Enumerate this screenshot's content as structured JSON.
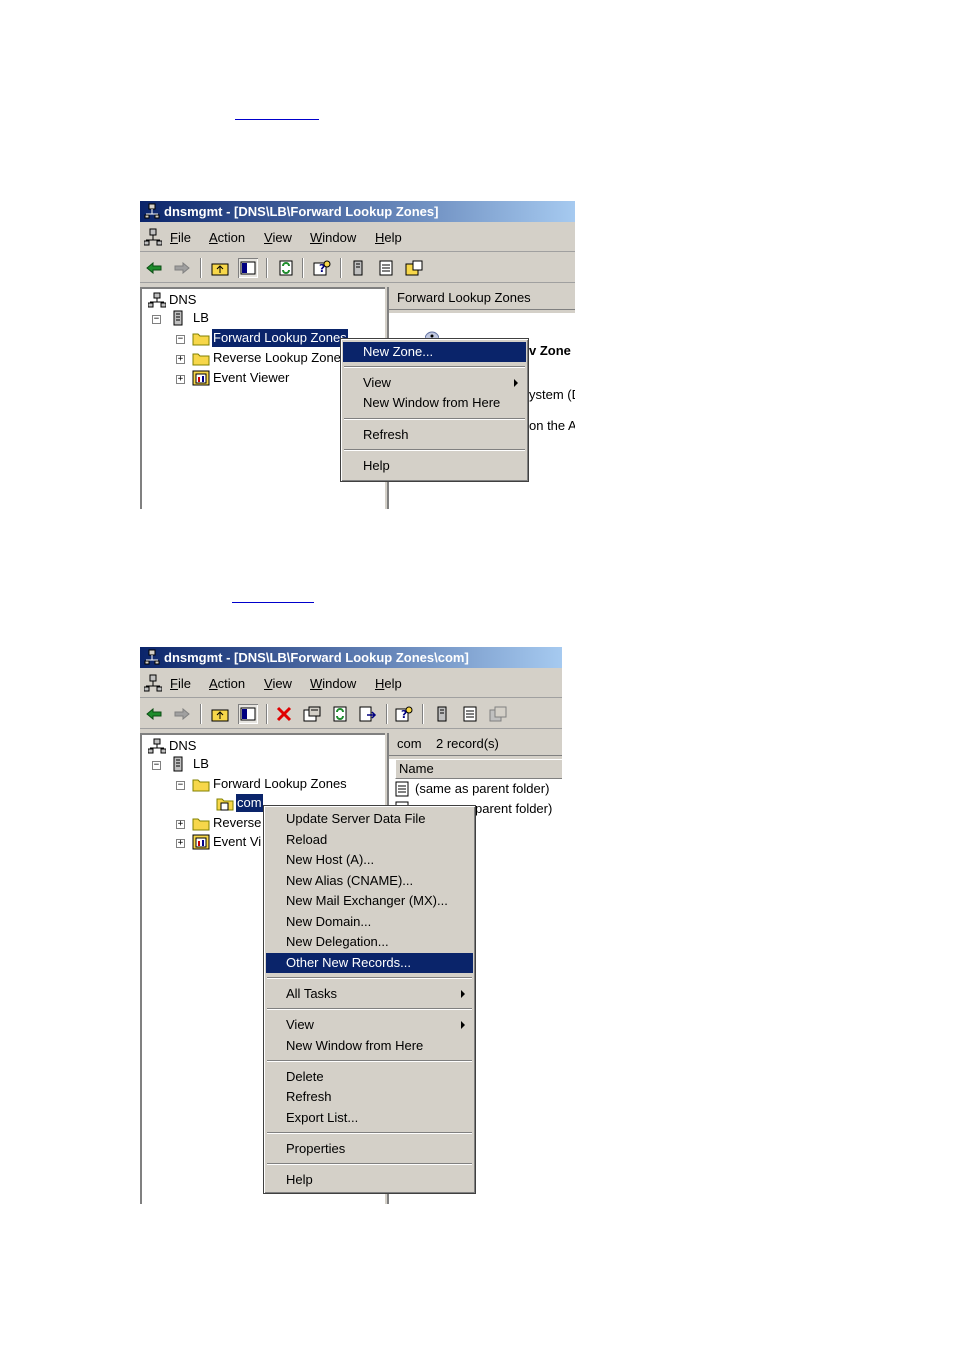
{
  "window1": {
    "title": "dnsmgmt - [DNS\\LB\\Forward Lookup Zones]",
    "menu": [
      "File",
      "Action",
      "View",
      "Window",
      "Help"
    ],
    "tree": {
      "root": "DNS",
      "server": "LB",
      "children": [
        "Forward Lookup Zones",
        "Reverse Lookup Zone",
        "Event Viewer"
      ]
    },
    "right_header": "Forward Lookup Zones",
    "right_fragments": [
      "v Zone",
      "ystem (D",
      "on the A"
    ],
    "context_menu": {
      "new_zone": "New Zone...",
      "view": "View",
      "new_window": "New Window from Here",
      "refresh": "Refresh",
      "help": "Help"
    }
  },
  "window2": {
    "title": "dnsmgmt - [DNS\\LB\\Forward Lookup Zones\\com]",
    "menu": [
      "File",
      "Action",
      "View",
      "Window",
      "Help"
    ],
    "tree": {
      "root": "DNS",
      "server": "LB",
      "forward": "Forward Lookup Zones",
      "zone": "com",
      "reverse": "Reverse",
      "event": "Event Vi"
    },
    "right_header": "com    2 record(s)",
    "column_name": "Name",
    "records": [
      "(same as parent folder)",
      "parent folder)"
    ],
    "context_menu": {
      "update": "Update Server Data File",
      "reload": "Reload",
      "new_host": "New Host (A)...",
      "new_alias": "New Alias (CNAME)...",
      "new_mx": "New Mail Exchanger (MX)...",
      "new_domain": "New Domain...",
      "new_delegation": "New Delegation...",
      "other_records": "Other New Records...",
      "all_tasks": "All Tasks",
      "view": "View",
      "new_window": "New Window from Here",
      "delete": "Delete",
      "refresh": "Refresh",
      "export": "Export List...",
      "properties": "Properties",
      "help": "Help"
    }
  },
  "colors": {
    "titlebar_start": "#0a246a",
    "titlebar_end": "#a6caf0",
    "selection": "#0a246a",
    "face": "#d4d0c8"
  }
}
